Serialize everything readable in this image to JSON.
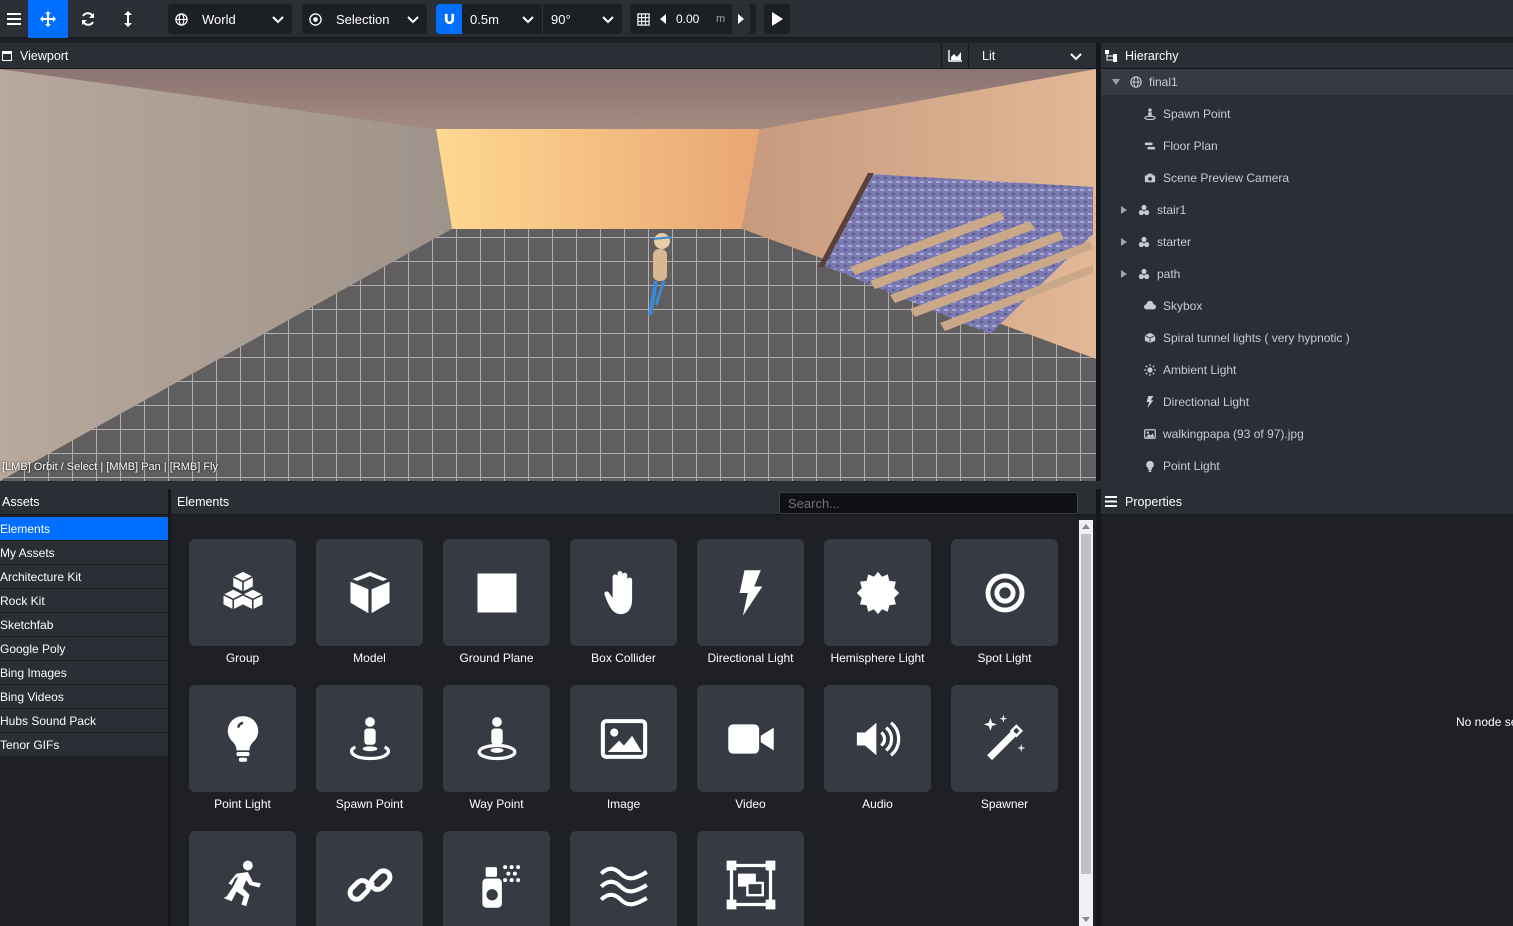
{
  "toolbar": {
    "transform_space": "World",
    "pivot_mode": "Selection",
    "snap_distance": "0.5m",
    "snap_rotation": "90°",
    "grid_height": "0.00",
    "grid_unit": "m"
  },
  "viewport": {
    "title": "Viewport",
    "render_mode": "Lit",
    "controls_hint": "[LMB] Orbit / Select | [MMB] Pan | [RMB] Fly"
  },
  "hierarchy": {
    "title": "Hierarchy",
    "items": [
      {
        "label": "final1",
        "icon": "globe-icon",
        "depth": 0,
        "expandable": true,
        "expanded": true,
        "selected": true
      },
      {
        "label": "Spawn Point",
        "icon": "spawn-point-icon",
        "depth": 1,
        "expandable": false
      },
      {
        "label": "Floor Plan",
        "icon": "floor-plan-icon",
        "depth": 1,
        "expandable": false
      },
      {
        "label": "Scene Preview Camera",
        "icon": "camera-icon",
        "depth": 1,
        "expandable": false
      },
      {
        "label": "stair1",
        "icon": "model-icon",
        "depth": 1,
        "expandable": true,
        "expanded": false
      },
      {
        "label": "starter",
        "icon": "model-icon",
        "depth": 1,
        "expandable": true,
        "expanded": false
      },
      {
        "label": "path",
        "icon": "model-icon",
        "depth": 1,
        "expandable": true,
        "expanded": false
      },
      {
        "label": "Skybox",
        "icon": "cloud-icon",
        "depth": 1,
        "expandable": false
      },
      {
        "label": "Spiral tunnel lights ( very hypnotic )",
        "icon": "cube-icon",
        "depth": 1,
        "expandable": false
      },
      {
        "label": "Ambient Light",
        "icon": "sun-icon",
        "depth": 1,
        "expandable": false
      },
      {
        "label": "Directional Light",
        "icon": "bolt-icon",
        "depth": 1,
        "expandable": false
      },
      {
        "label": "walkingpapa (93 of 97).jpg",
        "icon": "image-icon",
        "depth": 1,
        "expandable": false
      },
      {
        "label": "Point Light",
        "icon": "lightbulb-icon",
        "depth": 1,
        "expandable": false
      }
    ]
  },
  "properties": {
    "title": "Properties",
    "empty_text": "No node se"
  },
  "assets": {
    "title": "Assets",
    "sources": [
      "Elements",
      "My Assets",
      "Architecture Kit",
      "Rock Kit",
      "Sketchfab",
      "Google Poly",
      "Bing Images",
      "Bing Videos",
      "Hubs Sound Pack",
      "Tenor GIFs"
    ],
    "selected": "Elements"
  },
  "elements": {
    "title": "Elements",
    "search_placeholder": "Search...",
    "items": [
      {
        "label": "Group",
        "icon": "group-icon"
      },
      {
        "label": "Model",
        "icon": "model-icon"
      },
      {
        "label": "Ground Plane",
        "icon": "ground-plane-icon"
      },
      {
        "label": "Box Collider",
        "icon": "hand-icon"
      },
      {
        "label": "Directional Light",
        "icon": "bolt-icon"
      },
      {
        "label": "Hemisphere Light",
        "icon": "certificate-icon"
      },
      {
        "label": "Spot Light",
        "icon": "bullseye-icon"
      },
      {
        "label": "Point Light",
        "icon": "lightbulb-icon"
      },
      {
        "label": "Spawn Point",
        "icon": "spawn-point-icon"
      },
      {
        "label": "Way Point",
        "icon": "way-point-icon"
      },
      {
        "label": "Image",
        "icon": "image-icon"
      },
      {
        "label": "Video",
        "icon": "video-icon"
      },
      {
        "label": "Audio",
        "icon": "volume-icon"
      },
      {
        "label": "Spawner",
        "icon": "magic-wand-icon"
      },
      {
        "label": "",
        "icon": "running-icon"
      },
      {
        "label": "",
        "icon": "link-icon"
      },
      {
        "label": "",
        "icon": "spray-can-icon"
      },
      {
        "label": "",
        "icon": "water-icon"
      },
      {
        "label": "",
        "icon": "object-group-icon"
      }
    ]
  },
  "colors": {
    "accent": "#006eff",
    "panel": "#2a2e35",
    "background": "#1e2025",
    "tile": "#363a42"
  }
}
